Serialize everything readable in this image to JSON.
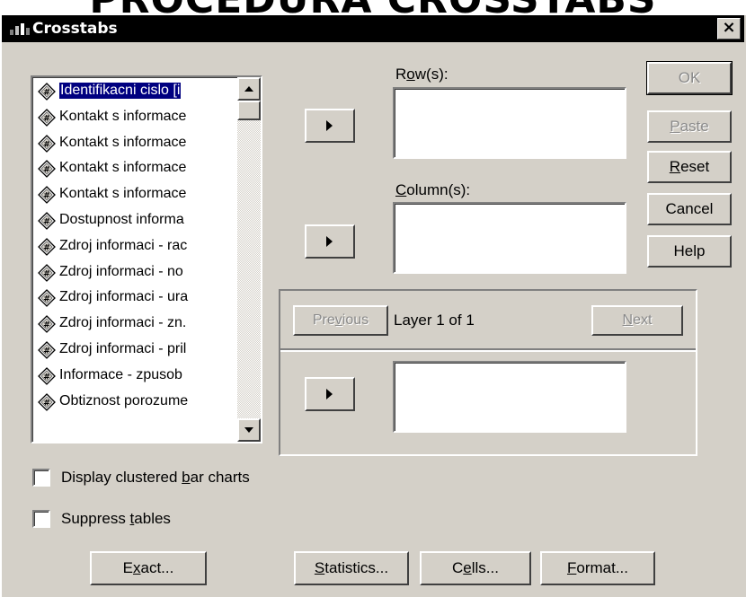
{
  "slide": {
    "heading": "PROCEDURA CROSSTABS"
  },
  "window": {
    "title": "Crosstabs",
    "close_glyph": "×"
  },
  "variables": {
    "items": [
      {
        "label": "Identifikacni cislo [i",
        "selected": true
      },
      {
        "label": "Kontakt s informace"
      },
      {
        "label": "Kontakt s informace"
      },
      {
        "label": "Kontakt s informace"
      },
      {
        "label": "Kontakt s informace"
      },
      {
        "label": "Dostupnost informa"
      },
      {
        "label": "Zdroj informaci - rac"
      },
      {
        "label": "Zdroj informaci - no"
      },
      {
        "label": "Zdroj informaci - ura"
      },
      {
        "label": "Zdroj informaci - zn."
      },
      {
        "label": "Zdroj informaci - pril"
      },
      {
        "label": "Informace - zpusob"
      },
      {
        "label": "Obtiznost porozume"
      }
    ],
    "item_icon": "scale-variable-icon"
  },
  "fields": {
    "rows_label_pre": "R",
    "rows_label_u": "o",
    "rows_label_post": "w(s):",
    "columns_label_u": "C",
    "columns_label_post": "olumn(s):"
  },
  "layer": {
    "previous_pre": "Pre",
    "previous_u": "v",
    "previous_post": "ious",
    "status": "Layer 1 of 1",
    "next_u": "N",
    "next_post": "ext"
  },
  "buttons": {
    "ok": "OK",
    "paste_u": "P",
    "paste_post": "aste",
    "reset_u": "R",
    "reset_post": "eset",
    "cancel": "Cancel",
    "help": "Help",
    "exact_pre": "E",
    "exact_u": "x",
    "exact_post": "act...",
    "statistics_u": "S",
    "statistics_post": "tatistics...",
    "cells_pre": "C",
    "cells_u": "e",
    "cells_post": "lls...",
    "format_u": "F",
    "format_post": "ormat..."
  },
  "options": {
    "clustered_pre": "Display clustered ",
    "clustered_u": "b",
    "clustered_post": "ar charts",
    "clustered_checked": false,
    "suppress_pre": "Suppress ",
    "suppress_u": "t",
    "suppress_post": "ables",
    "suppress_checked": false
  },
  "colors": {
    "dialog_face": "#d4d0c8",
    "titlebar": "#000000",
    "selection": "#000080"
  }
}
